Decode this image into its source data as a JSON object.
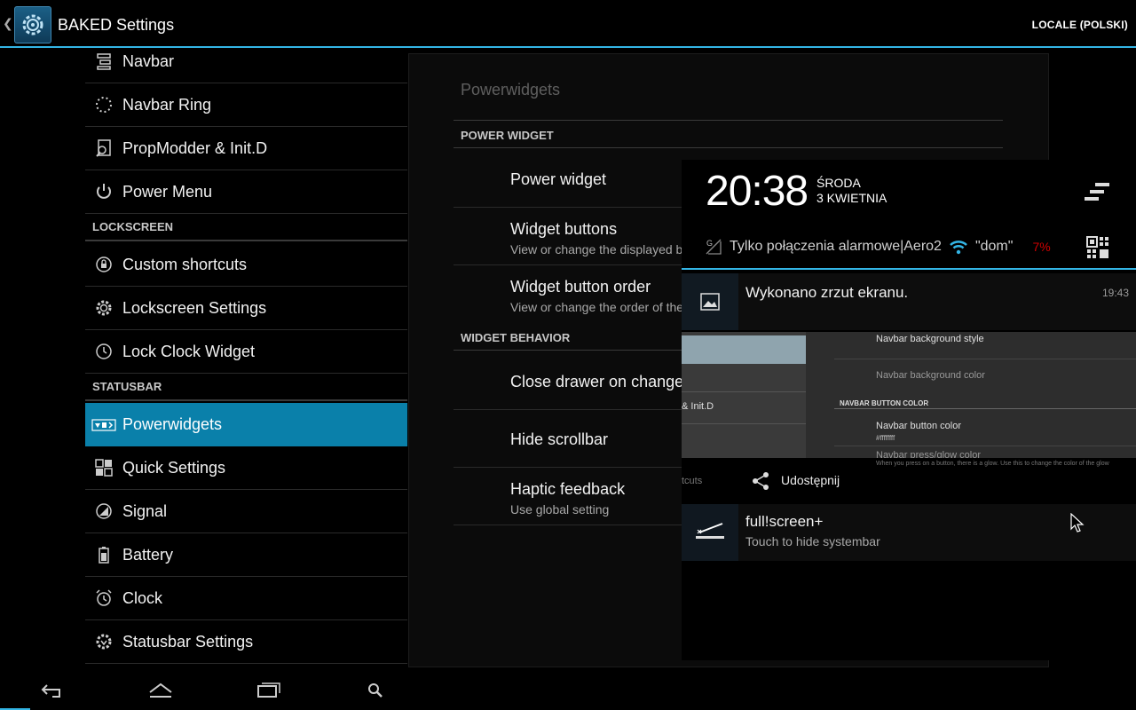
{
  "actionbar": {
    "title": "BAKED Settings",
    "action": "LOCALE (POLSKI)",
    "icon": "gear-app-icon"
  },
  "left_list": {
    "items": [
      {
        "label": "Navbar",
        "icon": "navbar-icon"
      },
      {
        "label": "Navbar Ring",
        "icon": "ring-icon"
      },
      {
        "label": "PropModder & Init.D",
        "icon": "propmodder-icon"
      },
      {
        "label": "Power Menu",
        "icon": "power-icon"
      }
    ],
    "header_lockscreen": "LOCKSCREEN",
    "lockscreen_items": [
      {
        "label": "Custom shortcuts",
        "icon": "lock-icon"
      },
      {
        "label": "Lockscreen Settings",
        "icon": "gear-icon"
      },
      {
        "label": "Lock Clock Widget",
        "icon": "clock-icon"
      }
    ],
    "header_statusbar": "STATUSBAR",
    "statusbar_items": [
      {
        "label": "Powerwidgets",
        "icon": "powerwidget-icon",
        "selected": true
      },
      {
        "label": "Quick Settings",
        "icon": "quicksettings-icon"
      },
      {
        "label": "Signal",
        "icon": "signal-icon"
      },
      {
        "label": "Battery",
        "icon": "battery-icon"
      },
      {
        "label": "Clock",
        "icon": "alarm-clock-icon"
      },
      {
        "label": "Statusbar Settings",
        "icon": "gear-icon"
      }
    ]
  },
  "pane": {
    "title": "Powerwidgets",
    "cat_power_widget": "POWER WIDGET",
    "power_widget": {
      "title": "Power widget"
    },
    "widget_buttons": {
      "title": "Widget buttons",
      "summary": "View or change the displayed b"
    },
    "widget_button_order": {
      "title": "Widget button order",
      "summary": "View or change the order of the"
    },
    "cat_widget_behavior": "WIDGET BEHAVIOR",
    "close_drawer": {
      "title": "Close drawer on change"
    },
    "hide_scrollbar": {
      "title": "Hide scrollbar"
    },
    "haptic_feedback": {
      "title": "Haptic feedback",
      "summary": "Use global setting"
    }
  },
  "shade": {
    "time": "20:38",
    "day": "ŚRODA",
    "date": "3 KWIETNIA",
    "carrier": "Tylko połączenia alarmowe|Aero2",
    "wifi_name": "\"dom\"",
    "battery": "7%",
    "notification_screenshot": {
      "title": "Wykonano zrzut ekranu.",
      "time": "19:43"
    },
    "preview": {
      "init_d": "& Init.D",
      "bg_style": "Navbar background style",
      "bg_color": "Navbar background color",
      "btn_color_cat": "NAVBAR BUTTON COLOR",
      "btn_color": "Navbar button color",
      "btn_color_val": "#ffffffff",
      "press_glow": "Navbar press/glow color",
      "press_glow_sub": "When you press on a button, there is a glow. Use this to change the color of the glow",
      "shortcuts_fragment": "tcuts"
    },
    "share_label": "Udostępnij",
    "notification_fullscreen": {
      "title": "full!screen+",
      "summary": "Touch to hide systembar"
    }
  },
  "navbar": {
    "buttons": [
      "back-icon",
      "home-icon",
      "recent-apps-icon",
      "search-icon"
    ]
  },
  "colors": {
    "accent": "#33b5e5",
    "selected": "#0a80aa",
    "battery_low": "#cc0000"
  }
}
